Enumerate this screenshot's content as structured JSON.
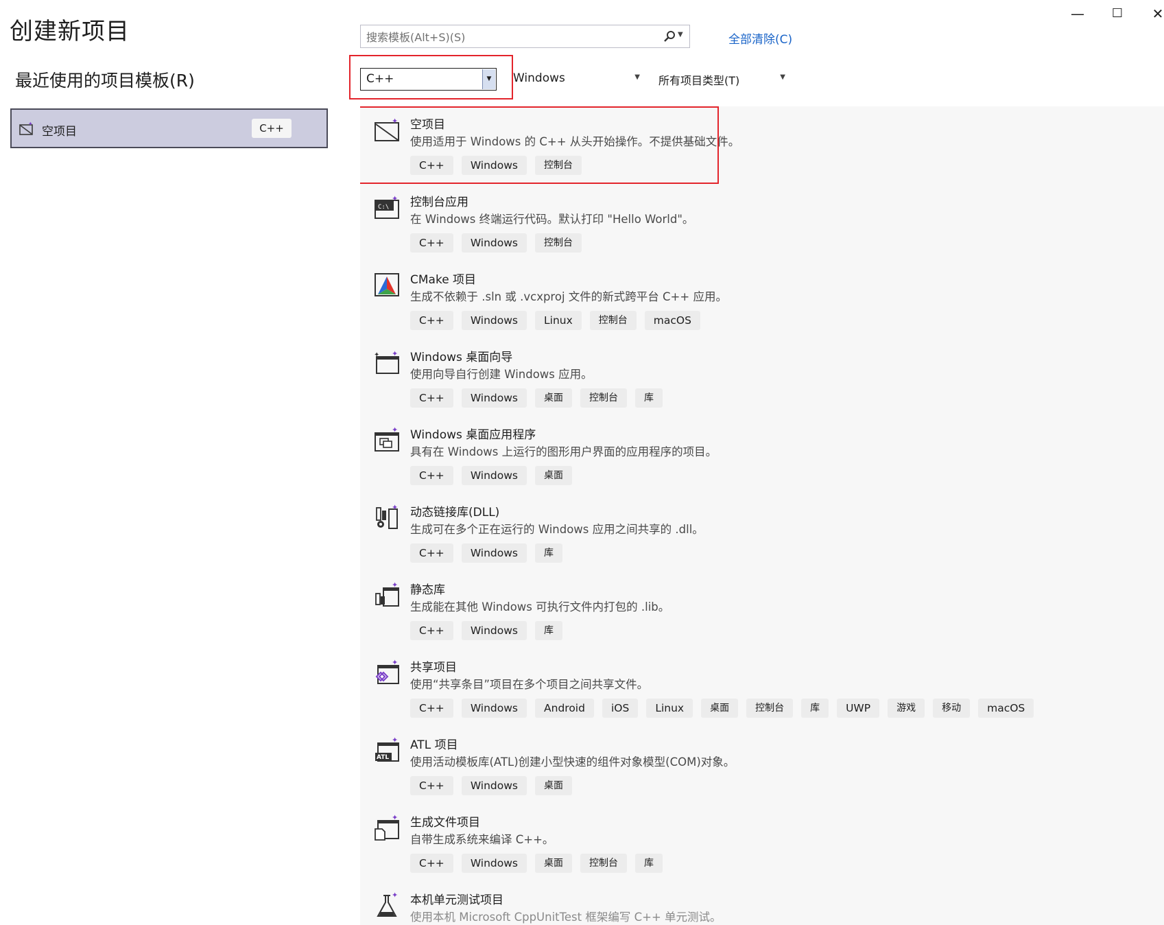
{
  "window": {
    "title": "创建新项目",
    "minimize": "—",
    "maximize": "☐",
    "close": "✕"
  },
  "recent": {
    "heading": "最近使用的项目模板(R)",
    "items": [
      {
        "name": "空项目",
        "tag": "C++",
        "icon": "empty-project-icon"
      }
    ]
  },
  "search": {
    "placeholder": "搜索模板(Alt+S)(S)",
    "value": ""
  },
  "clear_all": "全部清除(C)",
  "filters": {
    "language": "C++",
    "platform": "Windows",
    "project_type": "所有项目类型(T)"
  },
  "templates": [
    {
      "name": "空项目",
      "desc": "使用适用于 Windows 的 C++ 从头开始操作。不提供基础文件。",
      "tags": [
        "C++",
        "Windows",
        "控制台"
      ],
      "icon": "empty-project-icon",
      "selected": true
    },
    {
      "name": "控制台应用",
      "desc": "在 Windows 终端运行代码。默认打印 \"Hello World\"。",
      "tags": [
        "C++",
        "Windows",
        "控制台"
      ],
      "icon": "console-app-icon"
    },
    {
      "name": "CMake 项目",
      "desc": "生成不依赖于 .sln 或 .vcxproj 文件的新式跨平台 C++ 应用。",
      "tags": [
        "C++",
        "Windows",
        "Linux",
        "控制台",
        "macOS"
      ],
      "icon": "cmake-icon"
    },
    {
      "name": "Windows 桌面向导",
      "desc": "使用向导自行创建 Windows 应用。",
      "tags": [
        "C++",
        "Windows",
        "桌面",
        "控制台",
        "库"
      ],
      "icon": "desktop-wizard-icon"
    },
    {
      "name": "Windows 桌面应用程序",
      "desc": "具有在 Windows 上运行的图形用户界面的应用程序的项目。",
      "tags": [
        "C++",
        "Windows",
        "桌面"
      ],
      "icon": "desktop-app-icon"
    },
    {
      "name": "动态链接库(DLL)",
      "desc": "生成可在多个正在运行的 Windows 应用之间共享的 .dll。",
      "tags": [
        "C++",
        "Windows",
        "库"
      ],
      "icon": "dll-icon"
    },
    {
      "name": "静态库",
      "desc": "生成能在其他 Windows 可执行文件内打包的 .lib。",
      "tags": [
        "C++",
        "Windows",
        "库"
      ],
      "icon": "static-lib-icon"
    },
    {
      "name": "共享项目",
      "desc": "使用“共享条目”项目在多个项目之间共享文件。",
      "tags": [
        "C++",
        "Windows",
        "Android",
        "iOS",
        "Linux",
        "桌面",
        "控制台",
        "库",
        "UWP",
        "游戏",
        "移动",
        "macOS"
      ],
      "icon": "shared-project-icon"
    },
    {
      "name": "ATL 项目",
      "desc": "使用活动模板库(ATL)创建小型快速的组件对象模型(COM)对象。",
      "tags": [
        "C++",
        "Windows",
        "桌面"
      ],
      "icon": "atl-icon"
    },
    {
      "name": "生成文件项目",
      "desc": "自带生成系统来编译 C++。",
      "tags": [
        "C++",
        "Windows",
        "桌面",
        "控制台",
        "库"
      ],
      "icon": "makefile-icon"
    },
    {
      "name": "本机单元测试项目",
      "desc": "使用本机 Microsoft CppUnitTest 框架编写 C++ 单元测试。",
      "tags": [],
      "icon": "unit-test-icon"
    }
  ],
  "colors": {
    "accent_red": "#e3242b",
    "link_blue": "#1a64c8",
    "list_bg": "#f7f7f7",
    "tag_bg": "#ececec",
    "recent_selected_bg": "#ccccdf"
  }
}
